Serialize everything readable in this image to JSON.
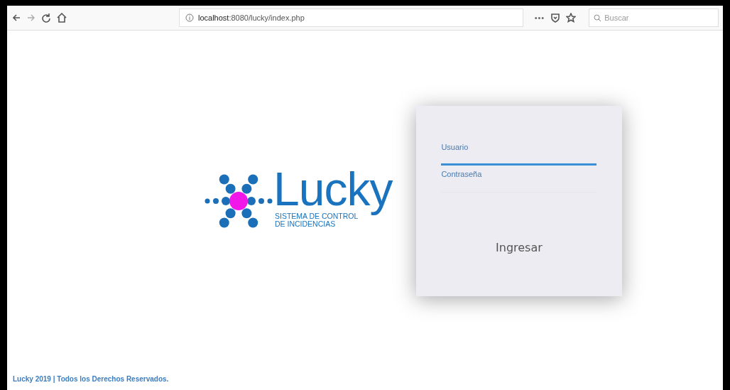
{
  "browser": {
    "url": "localhost:8080/lucky/index.php",
    "menu": "•••",
    "search_placeholder": "Buscar"
  },
  "logo": {
    "name": "Lucky",
    "subtitle": [
      "SISTEMA DE CONTROL",
      "DE INCIDENCIAS"
    ]
  },
  "login": {
    "fields": [
      {
        "label": "Usuario",
        "focused": true
      },
      {
        "label": "Contraseña",
        "focused": false
      }
    ],
    "button": "Ingresar"
  },
  "footer": "Lucky 2019 | Todos los Derechos Reservados."
}
